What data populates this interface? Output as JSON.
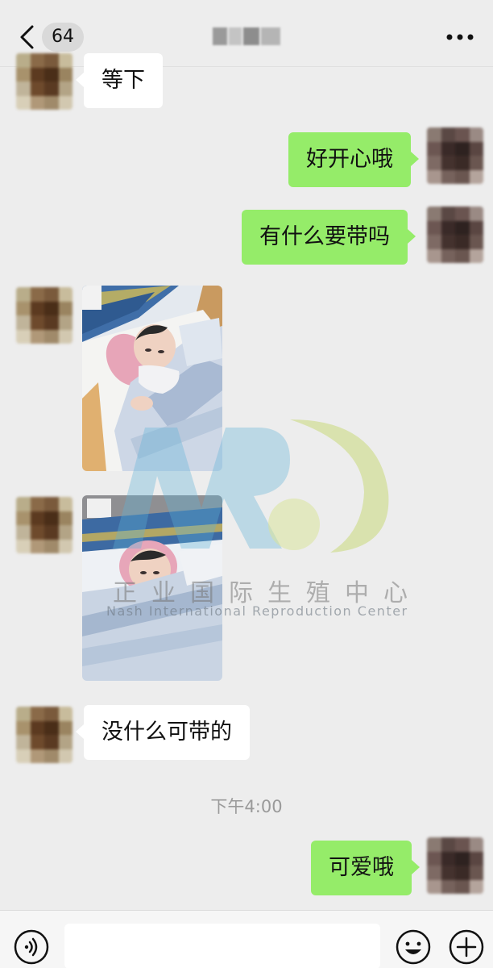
{
  "header": {
    "unread_count": "64",
    "title_obscured": true
  },
  "messages": [
    {
      "side": "left",
      "type": "text",
      "text": "等下"
    },
    {
      "side": "right",
      "type": "text",
      "text": "好开心哦"
    },
    {
      "side": "right",
      "type": "text",
      "text": "有什么要带吗"
    },
    {
      "side": "left",
      "type": "image",
      "description_icon": "photo"
    },
    {
      "side": "left",
      "type": "image",
      "description_icon": "photo"
    },
    {
      "side": "left",
      "type": "text",
      "text": "没什么可带的"
    },
    {
      "side": "right",
      "type": "text",
      "text": "可爱哦"
    }
  ],
  "timestamp": "下午4:00",
  "watermark": {
    "cn": "正业国际生殖中心",
    "en": "Nash International Reproduction Center"
  },
  "input_bar": {
    "placeholder": "",
    "icons": [
      "voice-icon",
      "emoji-icon",
      "plus-icon"
    ]
  },
  "colors": {
    "background": "#ededed",
    "bubble_green": "#95ec69",
    "bubble_white": "#ffffff",
    "timestamp": "#9a9a9a"
  }
}
